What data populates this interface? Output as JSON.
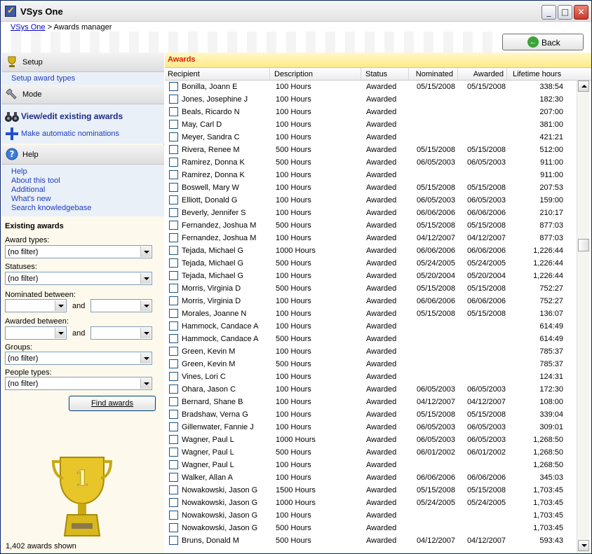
{
  "window": {
    "title": "VSys One"
  },
  "breadcrumb": {
    "root": "VSys One",
    "separator": ">",
    "current": "Awards manager"
  },
  "back_button": {
    "label": "Back"
  },
  "sidebar": {
    "setup": {
      "title": "Setup",
      "links": [
        "Setup award types"
      ]
    },
    "mode": {
      "title": "Mode",
      "items": [
        "View/edit existing awards",
        "Make automatic nominations"
      ]
    },
    "help": {
      "title": "Help",
      "links": [
        "Help",
        "About this tool",
        "Additional",
        "What's new",
        "Search knowledgebase"
      ]
    }
  },
  "filters": {
    "title": "Existing awards",
    "award_types_label": "Award types:",
    "award_types_value": "(no filter)",
    "statuses_label": "Statuses:",
    "statuses_value": "(no filter)",
    "nominated_label": "Nominated between:",
    "awarded_label": "Awarded between:",
    "and_label": "and",
    "groups_label": "Groups:",
    "groups_value": "(no filter)",
    "people_types_label": "People types:",
    "people_types_value": "(no filter)",
    "find_button": "Find awards"
  },
  "awards_count": "1,402 awards shown",
  "awards": {
    "title": "Awards",
    "columns": [
      "Recipient",
      "Description",
      "Status",
      "Nominated",
      "Awarded",
      "Lifetime hours"
    ],
    "rows": [
      [
        "Bonilla, Joann E",
        "100 Hours",
        "Awarded",
        "05/15/2008",
        "05/15/2008",
        "338:54"
      ],
      [
        "Jones, Josephine J",
        "100 Hours",
        "Awarded",
        "",
        "",
        "182:30"
      ],
      [
        "Beals, Ricardo N",
        "100 Hours",
        "Awarded",
        "",
        "",
        "207:00"
      ],
      [
        "May, Carl D",
        "100 Hours",
        "Awarded",
        "",
        "",
        "381:00"
      ],
      [
        "Meyer, Sandra C",
        "100 Hours",
        "Awarded",
        "",
        "",
        "421:21"
      ],
      [
        "Rivera, Renee M",
        "500 Hours",
        "Awarded",
        "05/15/2008",
        "05/15/2008",
        "512:00"
      ],
      [
        "Ramirez, Donna K",
        "500 Hours",
        "Awarded",
        "06/05/2003",
        "06/05/2003",
        "911:00"
      ],
      [
        "Ramirez, Donna K",
        "100 Hours",
        "Awarded",
        "",
        "",
        "911:00"
      ],
      [
        "Boswell, Mary W",
        "100 Hours",
        "Awarded",
        "05/15/2008",
        "05/15/2008",
        "207:53"
      ],
      [
        "Elliott, Donald G",
        "100 Hours",
        "Awarded",
        "06/05/2003",
        "06/05/2003",
        "159:00"
      ],
      [
        "Beverly, Jennifer S",
        "100 Hours",
        "Awarded",
        "06/06/2006",
        "06/06/2006",
        "210:17"
      ],
      [
        "Fernandez, Joshua M",
        "500 Hours",
        "Awarded",
        "05/15/2008",
        "05/15/2008",
        "877:03"
      ],
      [
        "Fernandez, Joshua M",
        "100 Hours",
        "Awarded",
        "04/12/2007",
        "04/12/2007",
        "877:03"
      ],
      [
        "Tejada, Michael G",
        "1000 Hours",
        "Awarded",
        "06/06/2006",
        "06/06/2006",
        "1,226:44"
      ],
      [
        "Tejada, Michael G",
        "500 Hours",
        "Awarded",
        "05/24/2005",
        "05/24/2005",
        "1,226:44"
      ],
      [
        "Tejada, Michael G",
        "100 Hours",
        "Awarded",
        "05/20/2004",
        "05/20/2004",
        "1,226:44"
      ],
      [
        "Morris, Virginia D",
        "500 Hours",
        "Awarded",
        "05/15/2008",
        "05/15/2008",
        "752:27"
      ],
      [
        "Morris, Virginia D",
        "100 Hours",
        "Awarded",
        "06/06/2006",
        "06/06/2006",
        "752:27"
      ],
      [
        "Morales, Joanne N",
        "100 Hours",
        "Awarded",
        "05/15/2008",
        "05/15/2008",
        "136:07"
      ],
      [
        "Hammock, Candace A",
        "100 Hours",
        "Awarded",
        "",
        "",
        "614:49"
      ],
      [
        "Hammock, Candace A",
        "500 Hours",
        "Awarded",
        "",
        "",
        "614:49"
      ],
      [
        "Green, Kevin M",
        "100 Hours",
        "Awarded",
        "",
        "",
        "785:37"
      ],
      [
        "Green, Kevin M",
        "500 Hours",
        "Awarded",
        "",
        "",
        "785:37"
      ],
      [
        "Vines, Lori C",
        "100 Hours",
        "Awarded",
        "",
        "",
        "124:31"
      ],
      [
        "Ohara, Jason C",
        "100 Hours",
        "Awarded",
        "06/05/2003",
        "06/05/2003",
        "172:30"
      ],
      [
        "Bernard, Shane B",
        "100 Hours",
        "Awarded",
        "04/12/2007",
        "04/12/2007",
        "108:00"
      ],
      [
        "Bradshaw, Verna G",
        "100 Hours",
        "Awarded",
        "05/15/2008",
        "05/15/2008",
        "339:04"
      ],
      [
        "Gillenwater, Fannie J",
        "100 Hours",
        "Awarded",
        "06/05/2003",
        "06/05/2003",
        "309:01"
      ],
      [
        "Wagner, Paul L",
        "1000 Hours",
        "Awarded",
        "06/05/2003",
        "06/05/2003",
        "1,268:50"
      ],
      [
        "Wagner, Paul L",
        "500 Hours",
        "Awarded",
        "06/01/2002",
        "06/01/2002",
        "1,268:50"
      ],
      [
        "Wagner, Paul L",
        "100 Hours",
        "Awarded",
        "",
        "",
        "1,268:50"
      ],
      [
        "Walker, Allan A",
        "100 Hours",
        "Awarded",
        "06/06/2006",
        "06/06/2006",
        "345:03"
      ],
      [
        "Nowakowski, Jason G",
        "1500 Hours",
        "Awarded",
        "05/15/2008",
        "05/15/2008",
        "1,703:45"
      ],
      [
        "Nowakowski, Jason G",
        "1000 Hours",
        "Awarded",
        "05/24/2005",
        "05/24/2005",
        "1,703:45"
      ],
      [
        "Nowakowski, Jason G",
        "100 Hours",
        "Awarded",
        "",
        "",
        "1,703:45"
      ],
      [
        "Nowakowski, Jason G",
        "500 Hours",
        "Awarded",
        "",
        "",
        "1,703:45"
      ],
      [
        "Bruns, Donald M",
        "500 Hours",
        "Awarded",
        "04/12/2007",
        "04/12/2007",
        "593:43"
      ]
    ]
  },
  "icons": {
    "setup": "trophy-icon",
    "mode": "wrench-icon",
    "view": "binoculars-icon",
    "nominate": "plus-icon",
    "help": "help-icon",
    "back": "back-arrow-icon"
  },
  "colors": {
    "awards_title": "#d92000",
    "link": "#1d3cc0",
    "header_band": "#ffe98a"
  }
}
